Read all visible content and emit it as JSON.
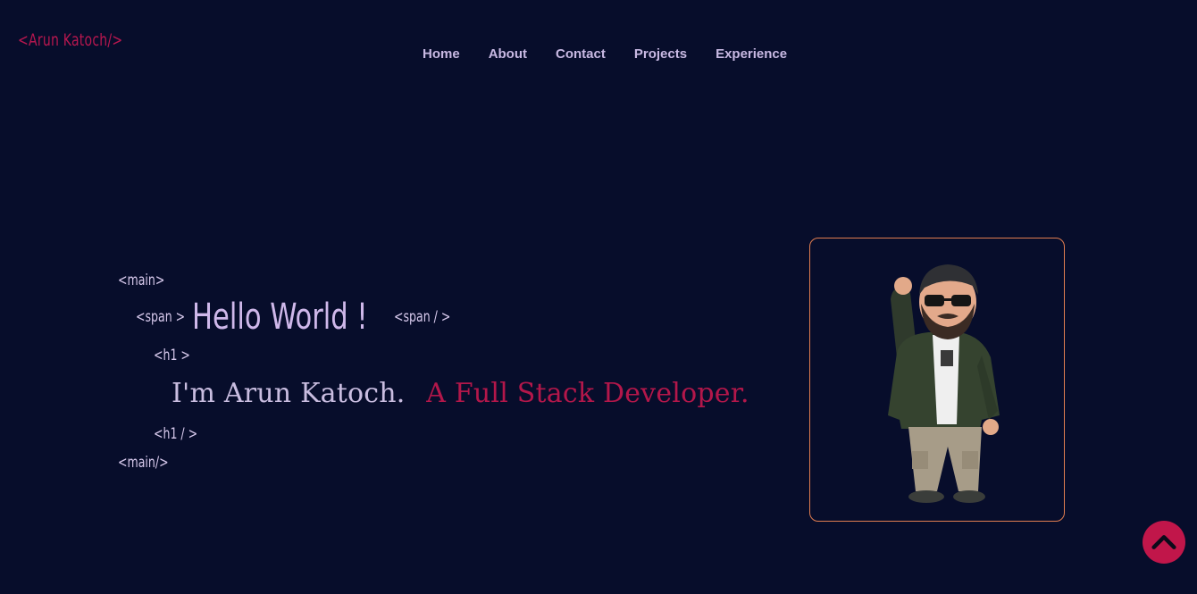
{
  "header": {
    "logo": "<Arun Katoch/>",
    "nav": [
      "Home",
      "About",
      "Contact",
      "Projects",
      "Experience"
    ]
  },
  "hero": {
    "main_open": "<main>",
    "span_open": "<span >",
    "greeting": "Hello World !",
    "span_close": "<span / >",
    "h1_open": "<h1 >",
    "name_text": "I'm Arun Katoch.",
    "role_text": "A Full Stack Developer.",
    "h1_close": "<h1 / >",
    "main_close": "<main/>"
  },
  "colors": {
    "background": "#070d2b",
    "accent": "#b8174f",
    "text": "#c9bde0",
    "card_border": "#e07d50"
  },
  "icons": {
    "scroll_top": "chevron-up-icon",
    "avatar": "avatar-image"
  }
}
